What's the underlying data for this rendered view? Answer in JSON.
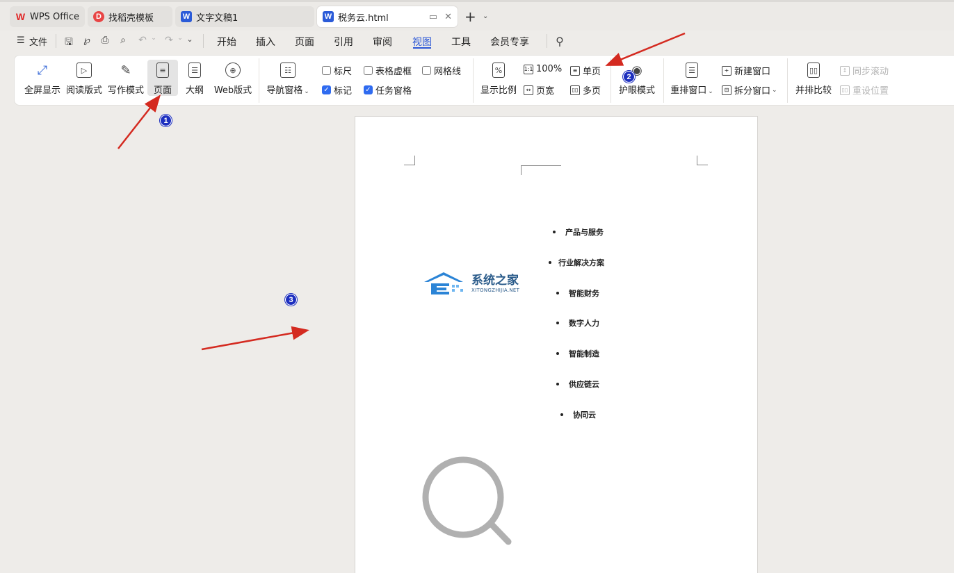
{
  "tabs": [
    {
      "label": "WPS Office",
      "icon": "wps-logo-icon",
      "color": "#e02424"
    },
    {
      "label": "找稻壳模板",
      "icon": "docer-icon",
      "color": "#e84545"
    },
    {
      "label": "文字文稿1",
      "icon": "word-doc-icon",
      "color": "#2b5bd8"
    },
    {
      "label": "税务云.html",
      "icon": "word-doc-icon",
      "color": "#2b5bd8",
      "active": true
    }
  ],
  "menu": {
    "file": "文件",
    "items": [
      "开始",
      "插入",
      "页面",
      "引用",
      "审阅",
      "视图",
      "工具",
      "会员专享"
    ],
    "active": "视图"
  },
  "ribbon": {
    "fullscreen": "全屏显示",
    "read_mode": "阅读版式",
    "write_mode": "写作模式",
    "page": "页面",
    "outline": "大纲",
    "web_layout": "Web版式",
    "nav_pane": "导航窗格",
    "ruler": "标尺",
    "table_grid": "表格虚框",
    "gridlines": "网格线",
    "marks": "标记",
    "task_pane": "任务窗格",
    "zoom": "显示比例",
    "zoom_100": "100%",
    "page_width": "页宽",
    "single_page": "单页",
    "multi_page": "多页",
    "eye_protect": "护眼模式",
    "arrange_windows": "重排窗口",
    "new_window": "新建窗口",
    "split_window": "拆分窗口",
    "side_by_side": "并排比较",
    "sync_scroll": "同步滚动",
    "reset_position": "重设位置"
  },
  "document": {
    "bullets": [
      "产品与服务",
      "行业解决方案",
      "智能财务",
      "数字人力",
      "智能制造",
      "供应链云",
      "协同云"
    ],
    "logo_text": "系统之家",
    "logo_sub": "XITONGZHIJIA.NET"
  },
  "annotations": {
    "badges": [
      "1",
      "2",
      "3"
    ],
    "arrow_color": "#d42a20",
    "badge_color": "#1d2fbf"
  }
}
